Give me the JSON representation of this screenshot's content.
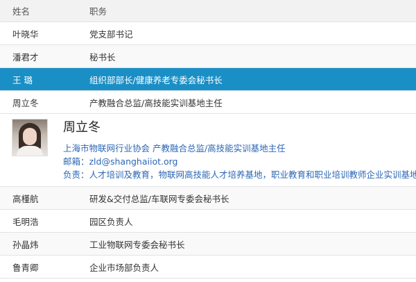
{
  "header": {
    "name": "姓名",
    "title": "职务"
  },
  "rows_top": [
    {
      "name": "叶晓华",
      "title": "党支部书记"
    },
    {
      "name": "潘君才",
      "title": "秘书长"
    },
    {
      "name": "王 璐",
      "title": "组织部部长/健康养老专委会秘书长"
    },
    {
      "name": "周立冬",
      "title": "产教融合总监/高技能实训基地主任"
    }
  ],
  "detail": {
    "name": "周立冬",
    "org_title": "上海市物联网行业协会 产教融合总监/高技能实训基地主任",
    "email": "邮箱：zld@shanghaiiot.org",
    "duties": "负责：人才培训及教育，物联网高技能人才培养基地，职业教育和职业培训教师企业实训基地"
  },
  "rows_bottom": [
    {
      "name": "高槿航",
      "title": "研发&交付总监/车联网专委会秘书长"
    },
    {
      "name": "毛明浩",
      "title": "园区负责人"
    },
    {
      "name": "孙晶炜",
      "title": "工业物联网专委会秘书长"
    },
    {
      "name": "鲁青卿",
      "title": "企业市场部负责人"
    }
  ],
  "colors": {
    "selected_row": "#1a8fc6",
    "link_text": "#2b67b5"
  }
}
